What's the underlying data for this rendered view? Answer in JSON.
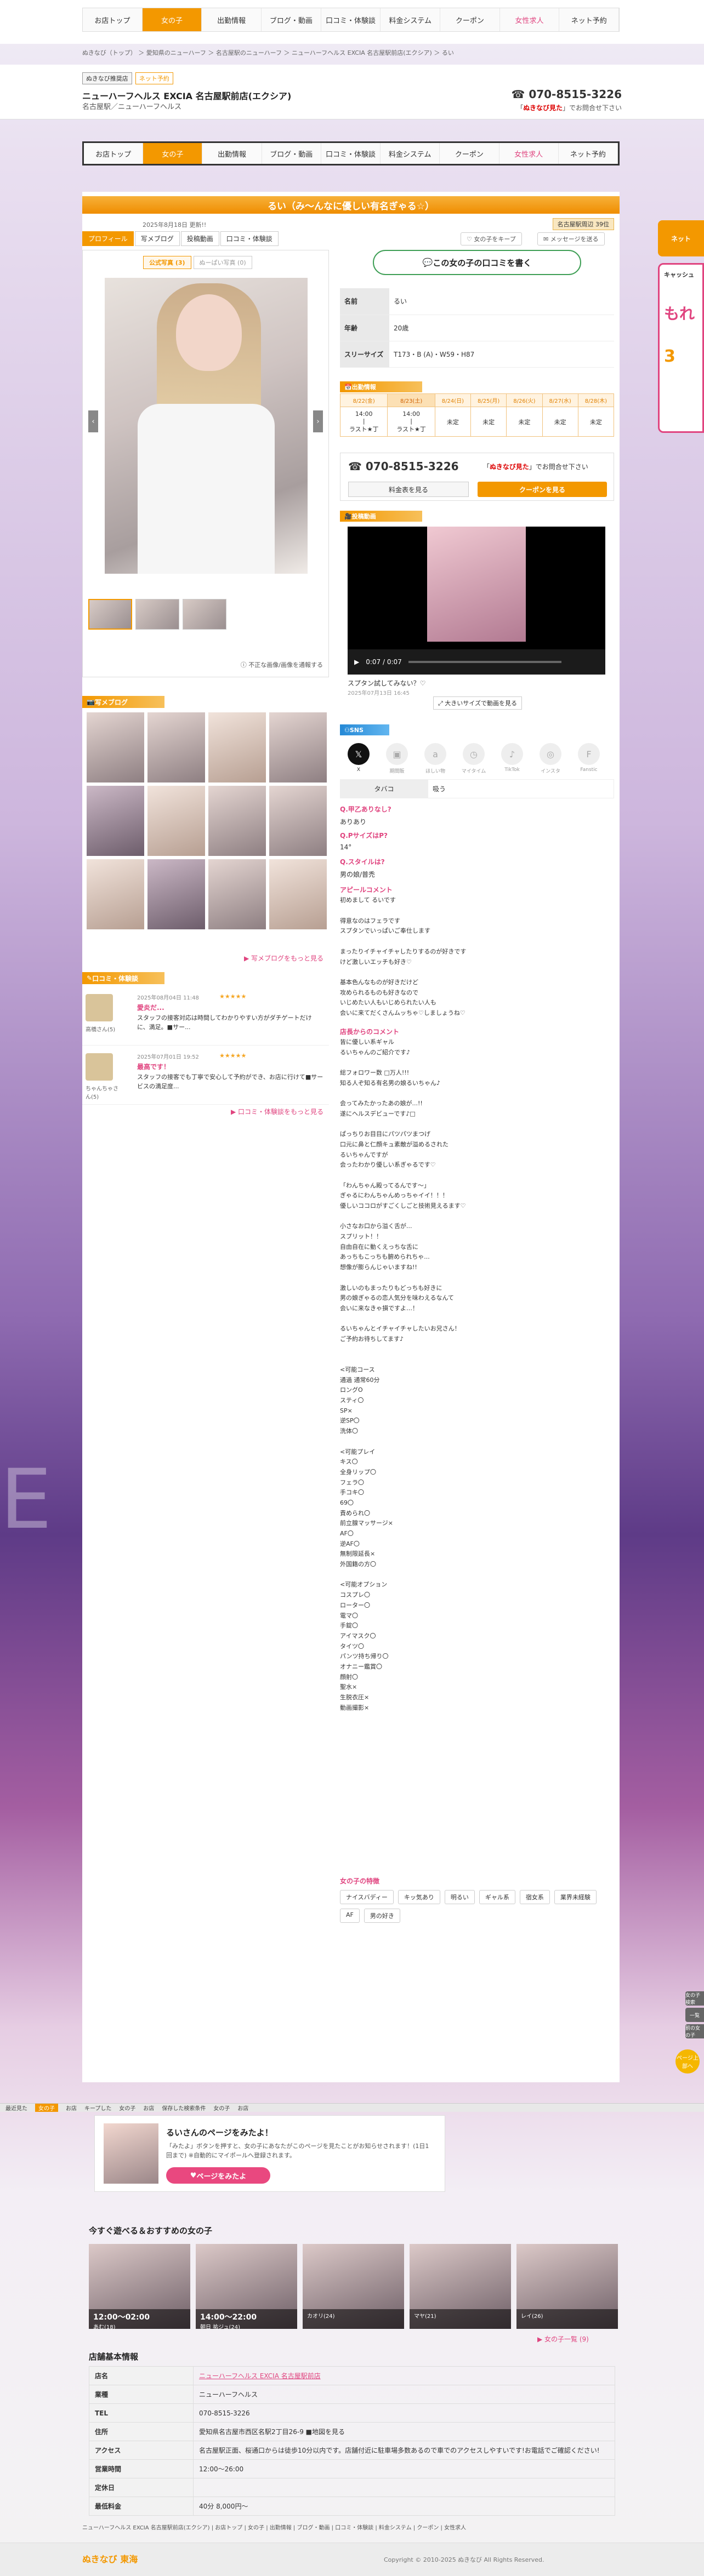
{
  "nav": [
    "お店トップ",
    "女の子",
    "出勤情報",
    "ブログ・動画",
    "口コミ・体験談",
    "料金システム",
    "クーポン",
    "女性求人",
    "ネット予約"
  ],
  "nav_active_index": 1,
  "breadcrumb": "ぬきなび（トップ） ＞ 愛知県のニューハーフ ＞ 名古屋駅のニューハーフ ＞ ニューハーフヘルス EXCIA 名古屋駅前店(エクシア) ＞ るい",
  "shop": {
    "badge1": "ぬきなび推奨店",
    "badge2": "ネット予約",
    "name": "ニューハーフヘルス EXCIA 名古屋駅前店(エクシア)",
    "category": "名古屋駅／ニューハーフヘルス",
    "tel": "070-8515-3226",
    "tel_note_pre": "「",
    "tel_note_bold": "ぬきなび見た",
    "tel_note_post": "」でお問合せ下さい"
  },
  "girl": {
    "title": "るい（み～んなに優しい有名ぎゃる☆）",
    "updated": "2025年8月18日 更新!!",
    "rank": "名古屋駅周辺 39位",
    "tabs": [
      "プロフィール",
      "写メブログ",
      "投稿動画",
      "口コミ・体験談"
    ],
    "fav_button": "女の子をキープ",
    "msg_button": "メッセージを送る",
    "photo_tabs": [
      "公式写真 (3)",
      "ぬーぱい写真 (0)"
    ],
    "report_link": "不正な画像/画像を通報する",
    "review_button": "この女の子の口コミを書く",
    "profile": [
      {
        "k": "名前",
        "v": "るい"
      },
      {
        "k": "年齢",
        "v": "20歳"
      },
      {
        "k": "スリーサイズ",
        "v": "T173・B (A)・W59・H87"
      }
    ],
    "schedule_title": "出勤情報",
    "schedule": [
      {
        "d": "8/22(金)",
        "v": "14:00\n|\nラスト★丁"
      },
      {
        "d": "8/23(土)",
        "v": "14:00\n|\nラスト★丁"
      },
      {
        "d": "8/24(日)",
        "v": "未定"
      },
      {
        "d": "8/25(月)",
        "v": "未定"
      },
      {
        "d": "8/26(火)",
        "v": "未定"
      },
      {
        "d": "8/27(水)",
        "v": "未定"
      },
      {
        "d": "8/28(木)",
        "v": "未定"
      }
    ],
    "tel_box": {
      "tel": "070-8515-3226",
      "note_bold": "ぬきなび見た",
      "note_post": "」でお問合せ下さい",
      "btn1": "料金表を見る",
      "btn2": "クーポンを見る"
    },
    "video": {
      "title": "投稿動画",
      "time": "0:07 / 0:07",
      "caption": "スプタン試してみない？♡",
      "date": "2025年07月13日 16:45",
      "button": "大きいサイズで動画を見る"
    },
    "sns_title": "SNS",
    "sns": [
      "X",
      "期間販",
      "ほしい物",
      "マイタイム",
      "TikTok",
      "インスタ",
      "Fanstic"
    ],
    "tobacco": {
      "k": "タバコ",
      "v": "吸う"
    },
    "qa": [
      {
        "q": "Q.甲乙ありなし?",
        "a": "ありあり"
      },
      {
        "q": "Q.PサイズはP?",
        "a": "14°"
      },
      {
        "q": "Q.スタイルは?",
        "a": "男の娘/普禿"
      }
    ],
    "appeal_title": "アピールコメント",
    "appeal": "初めまして るいです\n\n得意なのはフェラです\nスプタンでいっぱいご奉仕します\n\nまったりイチャイチャしたりするのが好きです\nけど激しいエッチも好き♡\n\n基本色んなものが好きだけど\n攻められるものも好きなので\nいじめたい人もいじめられたい人も\n会いに来てだくさんムッちゃ♡しましょうね♡",
    "shop_comment_title": "店長からのコメント",
    "shop_comment": "皆に優しい系ギャル\nるいちゃんのご紹介です♪\n\n総フォロワー数 □万人!!!\n知る人ぞ知る有名男の娘るいちゃん♪\n\n会ってみたかったあの娘が...!!\n遂にヘルスデビューです♪□\n\nぱっちりお目目にパツパツまつげ\n口元に鼻と仁顔キュ素敵が溢めるされた\nるいちゃんですが\n会ったわかり優しい系ぎゃるです♡\n\n「わんちゃん殿ってるんです～」\nぎゃるにわんちゃんめっちゃイイ！！！\n優しいココロがすごくしごと技術見えるます♡\n\n小さなお口から溢く舌が...\nスプリット！！\n自由自在に動くえっちな舌に\nあっちもこっちも腑められちゃ...\n想像が膨らんじゃいますね!!\n\n激しいのもまったりもどっちも好きに\n男の娘ぎゃるの恋人気分を味わえるなんて\n会いに来なきゃ損ですよ…！\n\nるいちゃんとイチャイチャしたいお兄さん！\nご予約お待ちしてます♪\n\n\n<可能コース\n通過 通常60分\nロングO\nスティ〇\nSP×\n逆SP〇\n洗体〇\n\n<可能プレイ\nキス〇\n全身リップ〇\nフェラ〇\n手コキ〇\n69〇\n責められ〇\n前立腺マッサージ×\nAF〇\n逆AF〇\n無制限延長×\n外国籍の方〇\n\n<可能オプション\nコスプレ〇\nローター〇\n電マ〇\n手錠〇\nアイマスク〇\nタイツ〇\nパンツ持ち帰り〇\nオナニー鑑賞〇\n顔射〇\n聖水×\n生脱衣圧×\n動画撮影×",
    "features_title": "女の子の特徴",
    "features": [
      "ナイスバディー",
      "キッ気あり",
      "明るい",
      "ギャル系",
      "宿女系",
      "業界未経験",
      "AF",
      "男の好き"
    ]
  },
  "blog_title": "写メブログ",
  "blog_more": "写メブログをもっと見る",
  "reviews_title": "口コミ・体験談",
  "reviews": [
    {
      "name": "高橋さん(5)",
      "date": "2025年08月04日 11:48",
      "stars": "★★★★★",
      "title": "愛炎だ...",
      "body": "スタッフの接客対応は時間してわかりやすい方がダチゲートだけに、満足。■サー..."
    },
    {
      "name": "ちゃんちゃさん(5)",
      "date": "2025年07月01日 19:52",
      "stars": "★★★★★",
      "title": "最高です！",
      "body": "スタッフの接客でも丁寧で安心して予約ができ、お店に行けて■サービスの満足度..."
    }
  ],
  "reviews_more": "口コミ・体験談をもっと見る",
  "banner": {
    "title": "るいさんのページをみたよ！",
    "text": "「みたよ」ボタンを押すと、女の子にあなたがこのページを見たことがお知らせされます！(1日1回まで) ※自動的にマイポールへ登録されます。",
    "button": "ページをみたよ"
  },
  "reco_title": "今すぐ遊べる＆おすすめの女の子",
  "reco": [
    {
      "time": "12:00〜02:00",
      "name": "あむ(18)"
    },
    {
      "time": "14:00〜22:00",
      "name": "朝日 祐ジュ(24)"
    },
    {
      "time": "",
      "name": "カオリ(24)"
    },
    {
      "time": "",
      "name": "マヤ(21)"
    },
    {
      "time": "",
      "name": "レイ(26)"
    }
  ],
  "reco_more": "女の子一覧 (9)",
  "shopinfo_title": "店舗基本情報",
  "shopinfo": [
    {
      "k": "店名",
      "v": "ニューハーフヘルス EXCIA 名古屋駅前店",
      "link": true
    },
    {
      "k": "業種",
      "v": "ニューハーフヘルス"
    },
    {
      "k": "TEL",
      "v": "070-8515-3226"
    },
    {
      "k": "住所",
      "v": "愛知県名古屋市西区名駅2丁目26-9 ■地図を見る"
    },
    {
      "k": "アクセス",
      "v": "名古屋駅正面、桜通口からは徒歩10分以内です。店舗付近に駐車場多数あるので車でのアクセスしやすいです!お電話でご確認ください!"
    },
    {
      "k": "営業時間",
      "v": "12:00〜26:00"
    },
    {
      "k": "定休日",
      "v": ""
    },
    {
      "k": "最低料金",
      "v": "40分 8,000円〜"
    }
  ],
  "footlinks": "ニューハーフヘルス EXCIA 名古屋駅前店(エクシア) | お店トップ | 女の子 | 出勤情報 | ブログ・動画 | 口コミ・体験談 | 料金システム | クーポン | 女性求人",
  "footer": {
    "logo": "ぬきなび 東海",
    "copy": "Copyright © 2010-2025 ぬきなび All Rights Reserved."
  },
  "sticky": [
    "最近見た",
    "女の子",
    "お店",
    "キープした",
    "女の子",
    "お店",
    "保存した検索条件",
    "女の子",
    "お店"
  ],
  "side": {
    "tab": "ネット",
    "ad1": "キャッシュ",
    "ad2": "もれ",
    "ad3": "3"
  },
  "sidebtns": [
    "女の子検索",
    "一覧",
    "前の女の子"
  ],
  "totop": "ページ上部へ"
}
